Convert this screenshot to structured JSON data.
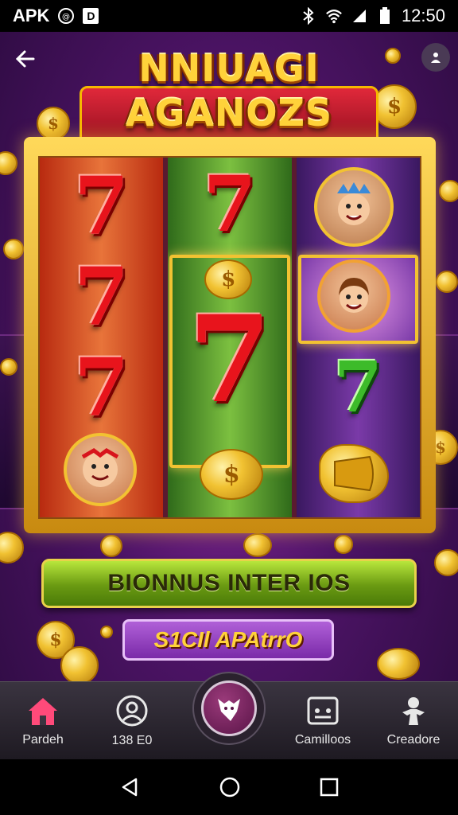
{
  "status_bar": {
    "app_label": "APK",
    "time": "12:50"
  },
  "game": {
    "title_line1": "NNIUAGI",
    "title_line2": "AGANOZS",
    "coin_symbol": "$"
  },
  "reels": {
    "reel1": [
      "7",
      "7",
      "7"
    ],
    "reel2": [
      "7",
      "7"
    ],
    "reel3": [
      "7"
    ]
  },
  "buttons": {
    "bonus_label": "BIONNUS INTER IOS",
    "secondary_label": "S1CIl APAtrrO"
  },
  "bottom_nav": {
    "items": [
      {
        "label": "Pardeh",
        "icon": "home-icon"
      },
      {
        "label": "138 E0",
        "icon": "avatar-icon"
      },
      {
        "label": "",
        "icon": "wolf-icon"
      },
      {
        "label": "Camilloos",
        "icon": "gamepad-icon"
      },
      {
        "label": "Creadore",
        "icon": "person-icon"
      }
    ]
  },
  "colors": {
    "accent_gold": "#f2c232",
    "home_active": "#ff4a7a",
    "bonus_green": "#7ab020",
    "secondary_purple": "#9a4ac8"
  }
}
